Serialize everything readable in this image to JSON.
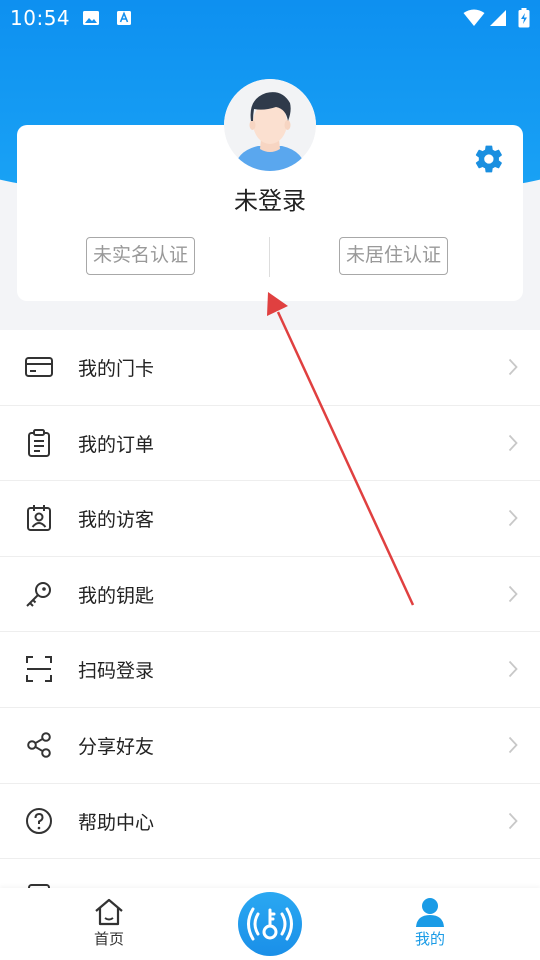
{
  "status_bar": {
    "time": "10:54"
  },
  "profile": {
    "title": "未登录",
    "real_name_cert": "未实名认证",
    "residence_cert": "未居住认证"
  },
  "menu": {
    "items": [
      {
        "label": "我的门卡",
        "icon": "card-icon"
      },
      {
        "label": "我的订单",
        "icon": "clipboard-icon"
      },
      {
        "label": "我的访客",
        "icon": "visitor-badge-icon"
      },
      {
        "label": "我的钥匙",
        "icon": "key-icon"
      },
      {
        "label": "扫码登录",
        "icon": "scan-icon"
      },
      {
        "label": "分享好友",
        "icon": "share-icon"
      },
      {
        "label": "帮助中心",
        "icon": "help-icon"
      }
    ]
  },
  "tabbar": {
    "home_label": "首页",
    "mine_label": "我的",
    "active_color": "#1a9be6"
  },
  "colors": {
    "accent": "#1a9be6",
    "annotation_arrow": "#e04040"
  }
}
